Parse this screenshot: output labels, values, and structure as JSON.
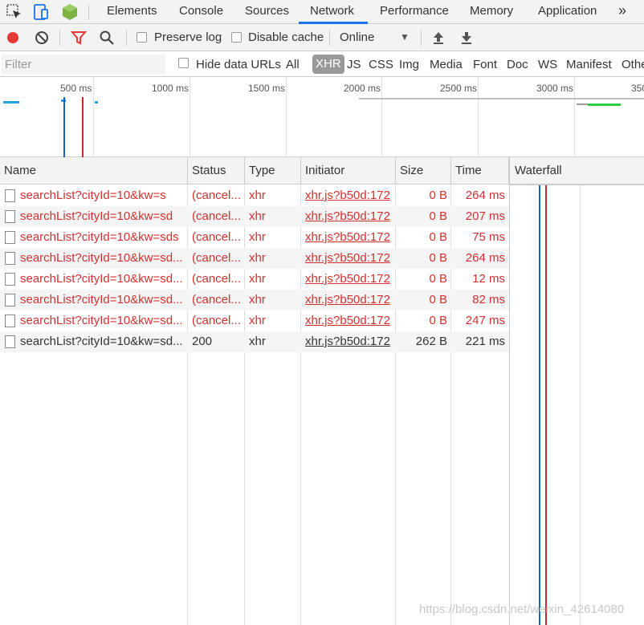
{
  "tabs": [
    "Elements",
    "Console",
    "Sources",
    "Network",
    "Performance",
    "Memory",
    "Application"
  ],
  "active_tab": "Network",
  "toolbar": {
    "preserve_log": "Preserve log",
    "disable_cache": "Disable cache",
    "throttling": "Online"
  },
  "filter": {
    "placeholder": "Filter",
    "hide_data_urls": "Hide data URLs",
    "types": [
      "All",
      "XHR",
      "JS",
      "CSS",
      "Img",
      "Media",
      "Font",
      "Doc",
      "WS",
      "Manifest",
      "Other"
    ],
    "active_type": "XHR"
  },
  "overview": {
    "ticks": [
      "500 ms",
      "1000 ms",
      "1500 ms",
      "2000 ms",
      "2500 ms",
      "3000 ms",
      "350"
    ]
  },
  "columns": {
    "name": "Name",
    "status": "Status",
    "type": "Type",
    "initiator": "Initiator",
    "size": "Size",
    "time": "Time",
    "waterfall": "Waterfall"
  },
  "requests": [
    {
      "name": "searchList?cityId=10&kw=s",
      "status": "(cancel...",
      "type": "xhr",
      "initiator": "xhr.js?b50d:172",
      "size": "0 B",
      "time": "264 ms",
      "error": true
    },
    {
      "name": "searchList?cityId=10&kw=sd",
      "status": "(cancel...",
      "type": "xhr",
      "initiator": "xhr.js?b50d:172",
      "size": "0 B",
      "time": "207 ms",
      "error": true
    },
    {
      "name": "searchList?cityId=10&kw=sds",
      "status": "(cancel...",
      "type": "xhr",
      "initiator": "xhr.js?b50d:172",
      "size": "0 B",
      "time": "75 ms",
      "error": true
    },
    {
      "name": "searchList?cityId=10&kw=sd...",
      "status": "(cancel...",
      "type": "xhr",
      "initiator": "xhr.js?b50d:172",
      "size": "0 B",
      "time": "264 ms",
      "error": true
    },
    {
      "name": "searchList?cityId=10&kw=sd...",
      "status": "(cancel...",
      "type": "xhr",
      "initiator": "xhr.js?b50d:172",
      "size": "0 B",
      "time": "12 ms",
      "error": true
    },
    {
      "name": "searchList?cityId=10&kw=sd...",
      "status": "(cancel...",
      "type": "xhr",
      "initiator": "xhr.js?b50d:172",
      "size": "0 B",
      "time": "82 ms",
      "error": true
    },
    {
      "name": "searchList?cityId=10&kw=sd...",
      "status": "(cancel...",
      "type": "xhr",
      "initiator": "xhr.js?b50d:172",
      "size": "0 B",
      "time": "247 ms",
      "error": true
    },
    {
      "name": "searchList?cityId=10&kw=sd...",
      "status": "200",
      "type": "xhr",
      "initiator": "xhr.js?b50d:172",
      "size": "262 B",
      "time": "221 ms",
      "error": false
    }
  ],
  "watermark": "https://blog.csdn.net/weixin_42614080",
  "colors": {
    "error": "#d32f2f",
    "accent": "#1a73e8",
    "record": "#e53935",
    "dom_content_loaded": "#1565c0",
    "load": "#c62828"
  }
}
